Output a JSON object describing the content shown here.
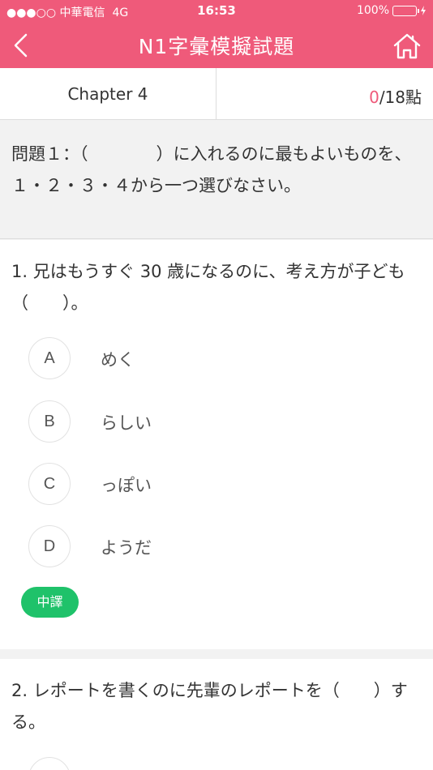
{
  "status_bar": {
    "carrier": "●●●○○ 中華電信",
    "network": "4G",
    "time": "16:53",
    "battery": "100%"
  },
  "nav": {
    "title": "N1字彙模擬試題",
    "back_icon": "chevron-left-icon",
    "home_icon": "home-icon"
  },
  "chapter_bar": {
    "chapter": "Chapter 4",
    "score_got": "0",
    "score_rest": "/18點"
  },
  "instruction": "問題１：（　　　　）に入れるのに最もよいものを、１・２・３・４から一つ選びなさい。",
  "questions": [
    {
      "text": "1. 兄はもうすぐ 30 歳になるのに、考え方が子ども（　　）。",
      "options": [
        {
          "letter": "A",
          "text": "めく"
        },
        {
          "letter": "B",
          "text": "らしい"
        },
        {
          "letter": "C",
          "text": "っぽい"
        },
        {
          "letter": "D",
          "text": "ようだ"
        }
      ],
      "translate_label": "中譯"
    },
    {
      "text": "2. レポートを書くのに先輩のレポートを（　　）する。"
    }
  ],
  "colors": {
    "brand_pink": "#ef5a7a",
    "translate_green": "#1fc26a",
    "battery_green": "#4cd964"
  }
}
